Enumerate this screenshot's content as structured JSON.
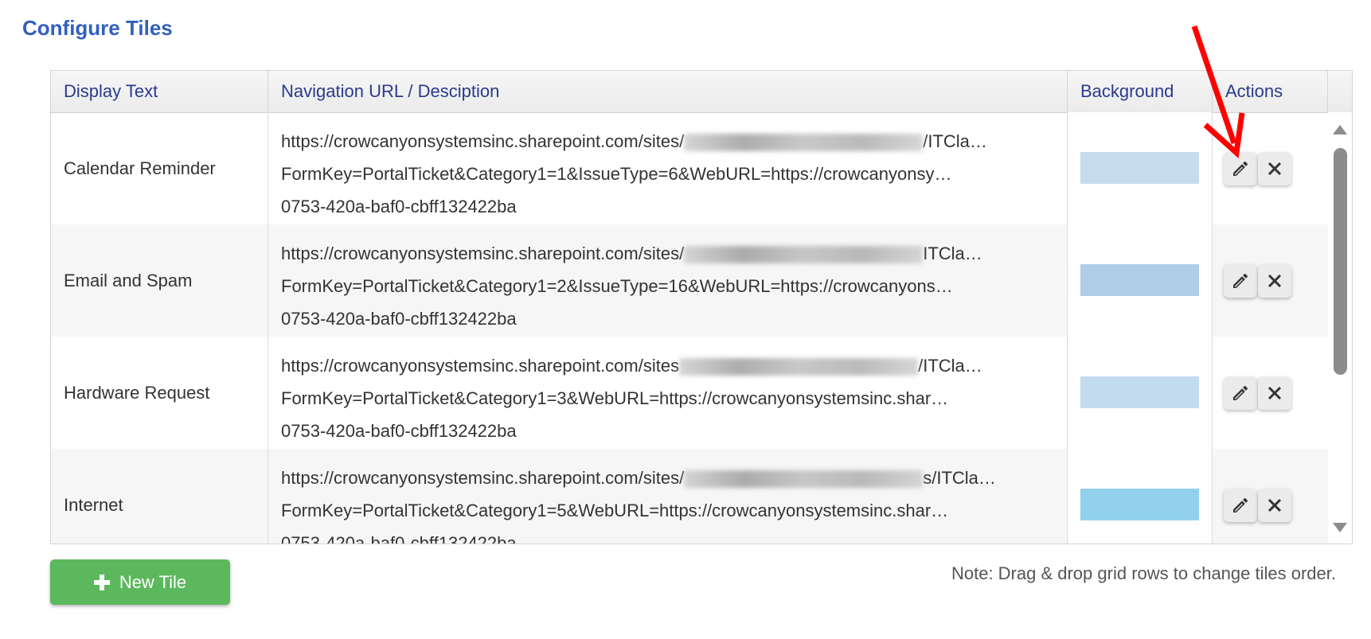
{
  "title": "Configure Tiles",
  "columns": [
    "Display Text",
    "Navigation URL / Desciption",
    "Background",
    "Actions"
  ],
  "rows": [
    {
      "display": "Calendar Reminder",
      "url_prefix": "https://crowcanyonsystemsinc.sharepoint.com/sites/",
      "url_suffix": "/ITCla…",
      "line2": "FormKey=PortalTicket&Category1=1&IssueType=6&WebURL=https://crowcanyonsy…",
      "line3": "0753-420a-baf0-cbff132422ba",
      "background": "#c6dbec"
    },
    {
      "display": "Email and Spam",
      "url_prefix": "https://crowcanyonsystemsinc.sharepoint.com/sites/",
      "url_suffix": "ITCla…",
      "line2": "FormKey=PortalTicket&Category1=2&IssueType=16&WebURL=https://crowcanyons…",
      "line3": "0753-420a-baf0-cbff132422ba",
      "background": "#afcde6"
    },
    {
      "display": "Hardware Request",
      "url_prefix": "https://crowcanyonsystemsinc.sharepoint.com/sites",
      "url_suffix": "/ITCla…",
      "line2": "FormKey=PortalTicket&Category1=3&WebURL=https://crowcanyonsystemsinc.shar…",
      "line3": "0753-420a-baf0-cbff132422ba",
      "background": "#c3dbee"
    },
    {
      "display": "Internet",
      "url_prefix": "https://crowcanyonsystemsinc.sharepoint.com/sites/",
      "url_suffix": "s/ITCla…",
      "line2": "FormKey=PortalTicket&Category1=5&WebURL=https://crowcanyonsystemsinc.shar…",
      "line3": "0753-420a-baf0-cbff132422ba",
      "background": "#92d1ec"
    }
  ],
  "actions": {
    "edit_icon": "pencil-icon",
    "delete_icon": "close-icon"
  },
  "new_tile_label": "New Tile",
  "note": "Note: Drag & drop grid rows to change tiles order.",
  "colors": {
    "title": "#3060c0",
    "header_text": "#2a3a8c",
    "new_button": "#5cb85c",
    "annotation_arrow": "#ff0000"
  }
}
